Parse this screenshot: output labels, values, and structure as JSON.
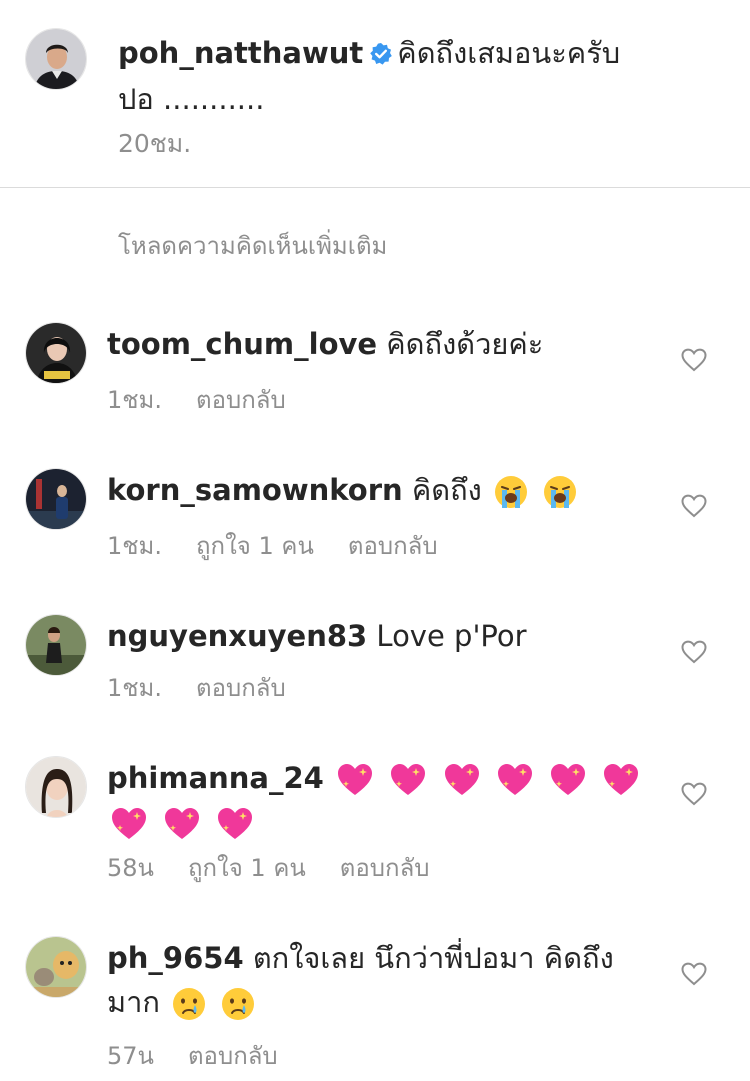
{
  "post": {
    "username": "poh_natthawut",
    "caption": "คิดถึงเสมอนะครับ",
    "caption_line2": "ปอ ...........",
    "time": "20ชม."
  },
  "load_more": "โหลดความคิดเห็นเพิ่มเติม",
  "comments": [
    {
      "username": "toom_chum_love",
      "text": "คิดถึงด้วยค่ะ",
      "time": "1ชม.",
      "likes": "",
      "reply": "ตอบกลับ"
    },
    {
      "username": "korn_samownkorn",
      "text": "คิดถึง",
      "time": "1ชม.",
      "likes": "ถูกใจ 1 คน",
      "reply": "ตอบกลับ"
    },
    {
      "username": "nguyenxuyen83",
      "text": "Love p'Por",
      "time": "1ชม.",
      "likes": "",
      "reply": "ตอบกลับ"
    },
    {
      "username": "phimanna_24",
      "text": "",
      "time": "58น",
      "likes": "ถูกใจ 1 คน",
      "reply": "ตอบกลับ"
    },
    {
      "username": "ph_9654",
      "text": "ตกใจเลย นึกว่าพี่ปอมา คิดถึง",
      "text_line2": "มาก",
      "time": "57น",
      "likes": "",
      "reply": "ตอบกลับ"
    }
  ],
  "icons": {
    "verified": "verified-badge-icon",
    "like": "heart-outline-icon",
    "loudly_crying": "loudly-crying-face-emoji",
    "sparkling_heart": "sparkling-heart-emoji",
    "crying": "crying-face-emoji"
  },
  "colors": {
    "text": "#262626",
    "secondary": "#8e8e8e",
    "verified": "#3897f0",
    "divider": "#dbdbdb"
  }
}
